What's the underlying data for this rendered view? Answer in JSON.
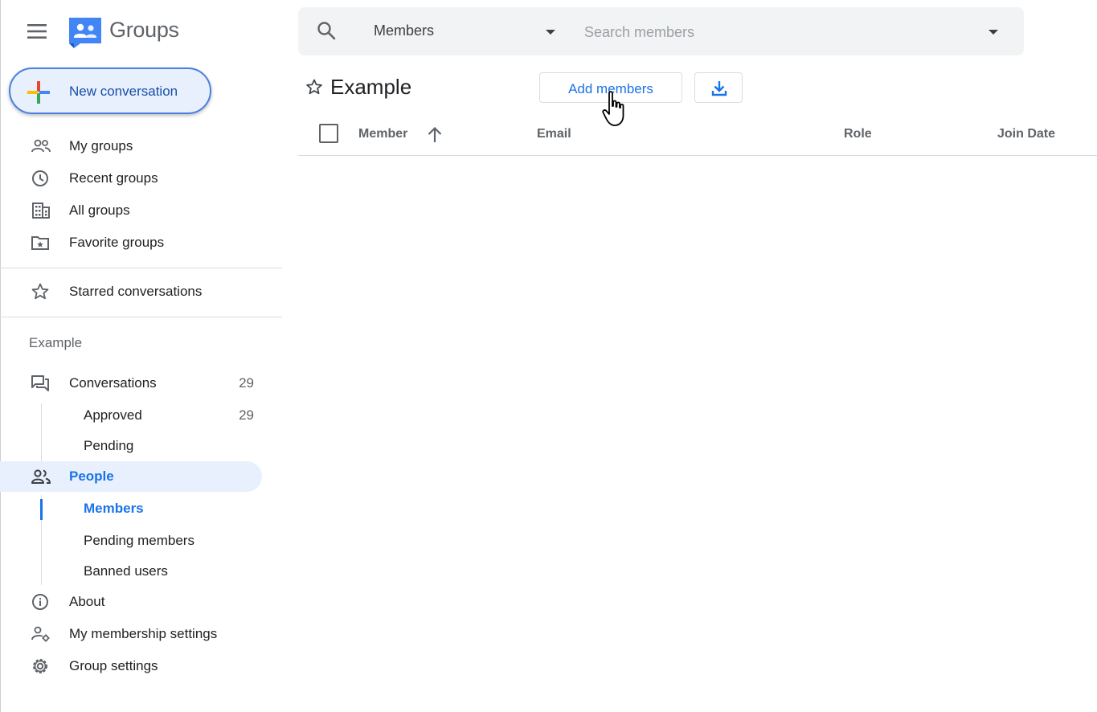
{
  "app": {
    "title": "Groups"
  },
  "new_conversation": {
    "label": "New conversation"
  },
  "sidebar": {
    "nav": [
      {
        "label": "My groups",
        "icon": "people-outline-icon"
      },
      {
        "label": "Recent groups",
        "icon": "clock-icon"
      },
      {
        "label": "All groups",
        "icon": "building-icon"
      },
      {
        "label": "Favorite groups",
        "icon": "folder-star-icon"
      }
    ],
    "starred": {
      "label": "Starred conversations",
      "icon": "star-outline-icon"
    },
    "group_name": "Example",
    "group_nav": {
      "conversations": {
        "label": "Conversations",
        "count": "29"
      },
      "approved": {
        "label": "Approved",
        "count": "29"
      },
      "pending": {
        "label": "Pending"
      },
      "people": {
        "label": "People"
      },
      "members": {
        "label": "Members"
      },
      "pending_members": {
        "label": "Pending members"
      },
      "banned_users": {
        "label": "Banned users"
      },
      "about": {
        "label": "About"
      },
      "membership_settings": {
        "label": "My membership settings"
      },
      "group_settings": {
        "label": "Group settings"
      }
    }
  },
  "search": {
    "scope": "Members",
    "placeholder": "Search members",
    "value": ""
  },
  "header": {
    "title": "Example",
    "add_members_label": "Add members"
  },
  "table": {
    "columns": [
      "Member",
      "Email",
      "Role",
      "Join Date"
    ],
    "sort": {
      "column": "Member",
      "direction": "ascending"
    },
    "rows": []
  },
  "colors": {
    "accent": "#1a73e8",
    "active_bg": "#e8f0fe",
    "text": "#202124",
    "muted": "#5f6368"
  }
}
